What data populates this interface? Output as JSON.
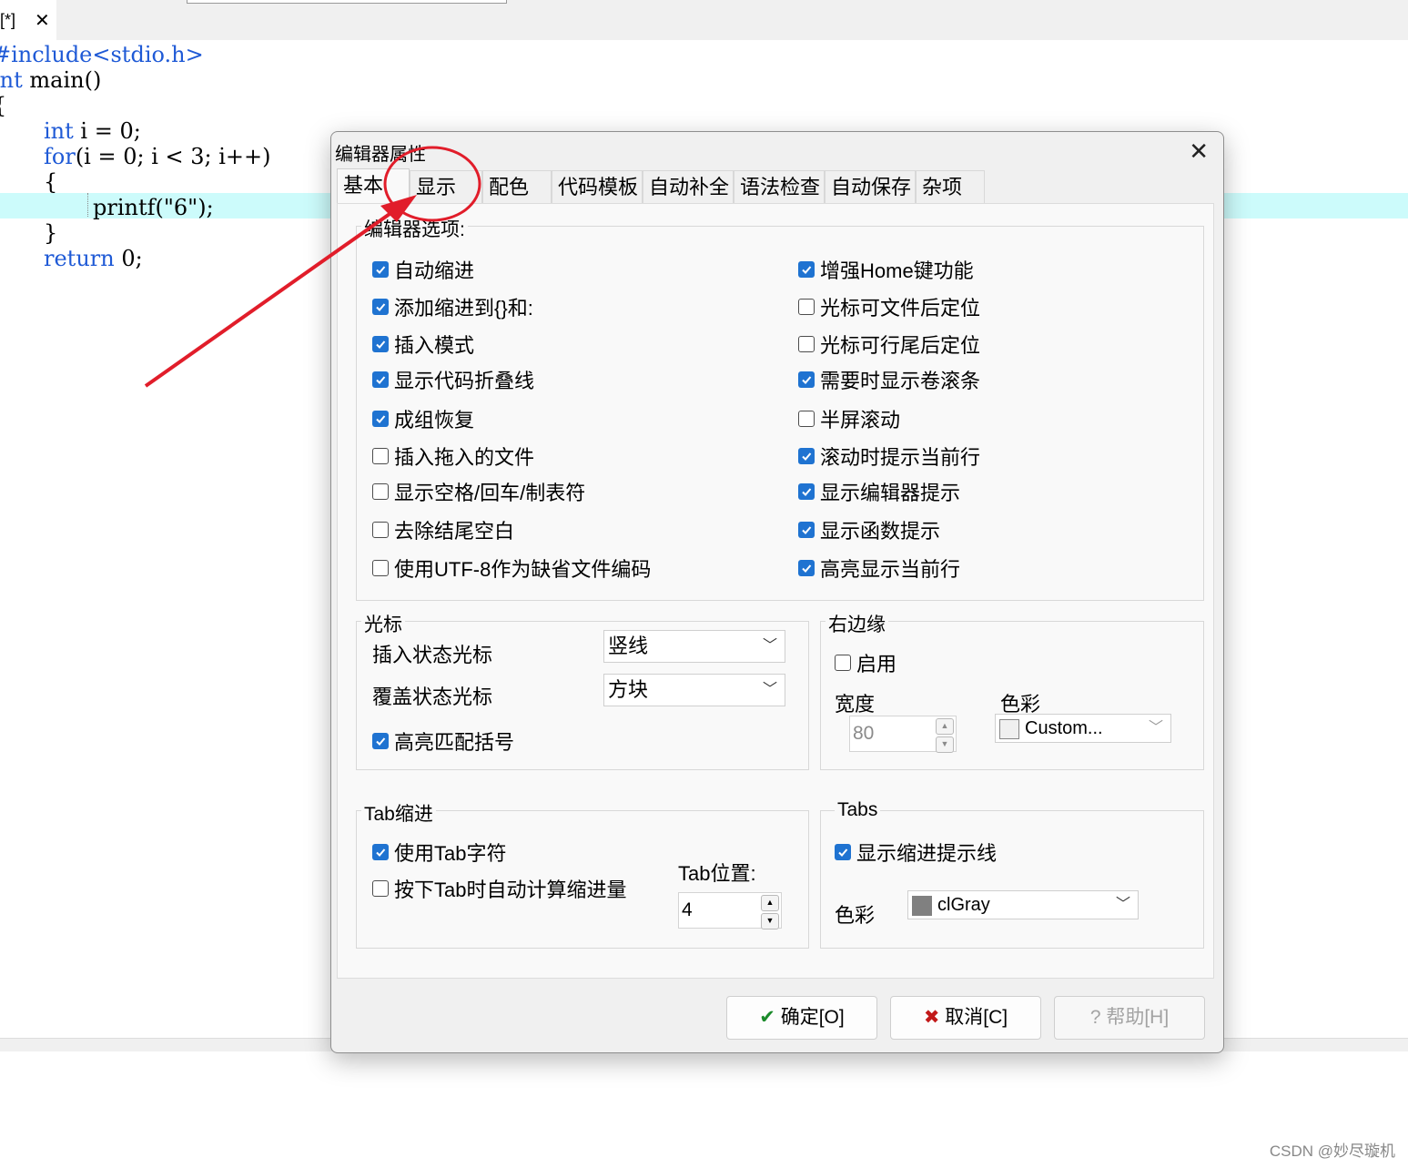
{
  "editor": {
    "tab_label": "[*]",
    "tab_close": "✕",
    "lines": {
      "l1": "#include<stdio.h>",
      "l2a": "int",
      "l2b": " main()",
      "l3": "{",
      "l4a": "int",
      "l4b": " i = 0;",
      "l5a": "for",
      "l5b": "(i = 0; i < 3; i++)",
      "l6": "{",
      "l7": "printf(\"6\");",
      "l8": "}",
      "l9a": "return",
      "l9b": " 0;"
    },
    "watermark": "CSDN @妙尽璇机"
  },
  "dialog": {
    "title": "编辑器属性",
    "close": "✕",
    "tabs": [
      "基本",
      "显示",
      "配色",
      "代码模板",
      "自动补全",
      "语法检查",
      "自动保存",
      "杂项"
    ],
    "active_tab": "基本",
    "editor_options": {
      "title": "编辑器选项:",
      "left": [
        {
          "label": "自动缩进",
          "checked": true
        },
        {
          "label": "添加缩进到{}和:",
          "checked": true
        },
        {
          "label": "插入模式",
          "checked": true
        },
        {
          "label": "显示代码折叠线",
          "checked": true
        },
        {
          "label": "成组恢复",
          "checked": true
        },
        {
          "label": "插入拖入的文件",
          "checked": false
        },
        {
          "label": "显示空格/回车/制表符",
          "checked": false
        },
        {
          "label": "去除结尾空白",
          "checked": false
        },
        {
          "label": "使用UTF-8作为缺省文件编码",
          "checked": false
        }
      ],
      "right": [
        {
          "label": "增强Home键功能",
          "checked": true
        },
        {
          "label": "光标可文件后定位",
          "checked": false
        },
        {
          "label": "光标可行尾后定位",
          "checked": false
        },
        {
          "label": "需要时显示卷滚条",
          "checked": true
        },
        {
          "label": "半屏滚动",
          "checked": false
        },
        {
          "label": "滚动时提示当前行",
          "checked": true
        },
        {
          "label": "显示编辑器提示",
          "checked": true
        },
        {
          "label": "显示函数提示",
          "checked": true
        },
        {
          "label": "高亮显示当前行",
          "checked": true
        }
      ]
    },
    "caret": {
      "title": "光标",
      "insert_label": "插入状态光标",
      "insert_value": "竖线",
      "overwrite_label": "覆盖状态光标",
      "overwrite_value": "方块",
      "match_brackets": {
        "label": "高亮匹配括号",
        "checked": true
      }
    },
    "right_margin": {
      "title": "右边缘",
      "enable": {
        "label": "启用",
        "checked": false
      },
      "width_label": "宽度",
      "width_value": "80",
      "color_label": "色彩",
      "color_value": "Custom...",
      "color_hex": "#f0f0f0"
    },
    "tab_indent": {
      "title": "Tab缩进",
      "use_tab": {
        "label": "使用Tab字符",
        "checked": true
      },
      "auto_calc": {
        "label": "按下Tab时自动计算缩进量",
        "checked": false
      },
      "tab_pos_label": "Tab位置:",
      "tab_pos_value": "4"
    },
    "tabs_group": {
      "title": "Tabs",
      "show_guides": {
        "label": "显示缩进提示线",
        "checked": true
      },
      "color_label": "色彩",
      "color_value": "clGray",
      "color_hex": "#808080"
    },
    "buttons": {
      "ok": "确定[O]",
      "cancel": "取消[C]",
      "help": "帮助[H]"
    }
  },
  "colors": {
    "accent": "#1f73d1",
    "annotation": "#e11d2a",
    "highlight_row": "#ccfbfb",
    "keyword": "#1f5ad6"
  }
}
